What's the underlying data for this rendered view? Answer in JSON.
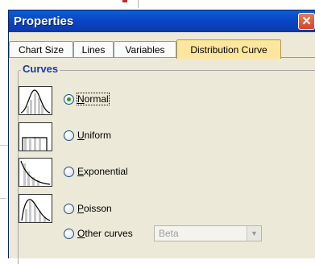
{
  "window": {
    "title": "Properties",
    "close_label": "✕"
  },
  "tabs": [
    {
      "label": "Chart Size",
      "active": false
    },
    {
      "label": "Lines",
      "active": false
    },
    {
      "label": "Variables",
      "active": false
    },
    {
      "label": "Distribution Curve",
      "active": true
    }
  ],
  "curves": {
    "group_label": "Curves",
    "options": [
      {
        "mnemonic": "N",
        "rest": "ormal",
        "checked": true,
        "icon": "normal-curve-icon"
      },
      {
        "mnemonic": "U",
        "rest": "niform",
        "checked": false,
        "icon": "uniform-curve-icon"
      },
      {
        "mnemonic": "E",
        "rest": "xponential",
        "checked": false,
        "icon": "exponential-curve-icon"
      },
      {
        "mnemonic": "P",
        "rest": "oisson",
        "checked": false,
        "icon": "poisson-curve-icon"
      },
      {
        "mnemonic": "O",
        "rest": "ther curves",
        "checked": false,
        "icon": null
      }
    ],
    "other_select": {
      "value": "Beta",
      "enabled": false
    }
  },
  "colors": {
    "title_bar": "#0a46c4",
    "active_tab": "#fde79f",
    "group_label": "#153da8",
    "radio_dot": "#2f9b2f"
  }
}
